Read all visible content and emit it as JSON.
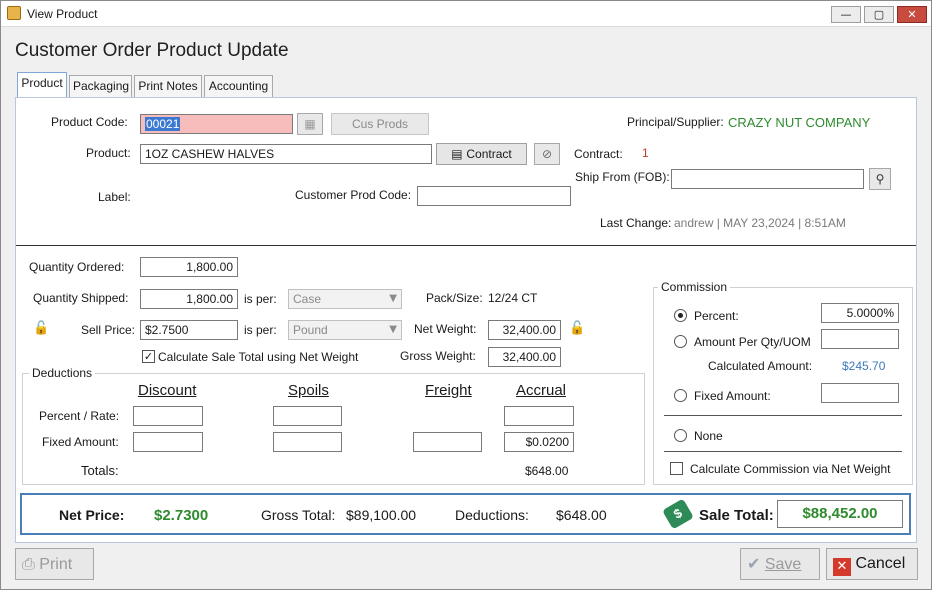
{
  "window": {
    "title": "View Product",
    "minimize": "—",
    "maximize": "▢",
    "close": "✕"
  },
  "heading": "Customer Order Product Update",
  "tabs": [
    "Product",
    "Packaging",
    "Print Notes",
    "Accounting"
  ],
  "product": {
    "code_label": "Product Code:",
    "code_value": "00021",
    "cus_prods_label": "Cus Prods",
    "product_label": "Product:",
    "product_value": "1OZ CASHEW HALVES",
    "contract_btn": "Contract",
    "label_label": "Label:",
    "customer_prod_code_label": "Customer Prod Code:",
    "customer_prod_code_value": "",
    "principal_label": "Principal/Supplier:",
    "principal_value": "CRAZY NUT COMPANY",
    "contract_label": "Contract:",
    "contract_value": "1",
    "ship_from_label": "Ship From (FOB):",
    "ship_from_value": "",
    "last_change_label": "Last Change:",
    "last_change_value": "andrew | MAY 23,2024 |  8:51AM"
  },
  "quantity": {
    "ordered_label": "Quantity Ordered:",
    "ordered_value": "1,800.00",
    "shipped_label": "Quantity Shipped:",
    "shipped_value": "1,800.00",
    "is_per_label": "is per:",
    "shipped_per": "Case",
    "pack_size_label": "Pack/Size:",
    "pack_size_value": "12/24 CT",
    "sell_price_label": "Sell Price:",
    "sell_price_value": "$2.7500",
    "sell_per": "Pound",
    "net_weight_label": "Net Weight:",
    "net_weight_value": "32,400.00",
    "gross_weight_label": "Gross Weight:",
    "gross_weight_value": "32,400.00",
    "calc_net_label": "Calculate Sale Total using Net Weight",
    "calc_net_checked": true
  },
  "deductions": {
    "legend": "Deductions",
    "columns": [
      "Discount",
      "Spoils",
      "Freight",
      "Accrual"
    ],
    "percent_label": "Percent / Rate:",
    "fixed_label": "Fixed Amount:",
    "totals_label": "Totals:",
    "accrual_fixed": "$0.0200",
    "total_value": "$648.00"
  },
  "commission": {
    "legend": "Commission",
    "percent_label": "Percent:",
    "percent_value": "5.0000%",
    "amount_per_label": "Amount Per Qty/UOM",
    "amount_per_value": "",
    "calculated_label": "Calculated Amount:",
    "calculated_value": "$245.70",
    "fixed_label": "Fixed Amount:",
    "fixed_value": "",
    "none_label": "None",
    "via_net_label": "Calculate Commission via Net Weight",
    "selected": "percent"
  },
  "summary": {
    "net_price_label": "Net Price:",
    "net_price_value": "$2.7300",
    "gross_total_label": "Gross Total:",
    "gross_total_value": "$89,100.00",
    "deductions_label": "Deductions:",
    "deductions_value": "$648.00",
    "sale_total_label": "Sale Total:",
    "sale_total_value": "$88,452.00"
  },
  "buttons": {
    "print": "Print",
    "save": "Save",
    "cancel": "Cancel"
  },
  "colors": {
    "accent_blue": "#4a7fb6",
    "green": "#2e8b2e",
    "required_pink": "#f7bcbc"
  }
}
